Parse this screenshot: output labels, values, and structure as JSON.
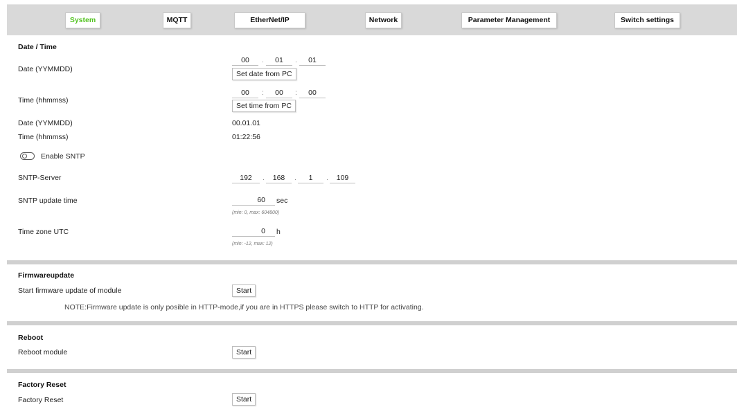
{
  "nav": {
    "tabs": [
      "System",
      "MQTT",
      "EtherNet/IP",
      "Network",
      "Parameter Management",
      "Switch settings"
    ],
    "active_color": "#55c323"
  },
  "datetime": {
    "heading": "Date / Time",
    "date_label": "Date (YYMMDD)",
    "date_segments": [
      "00",
      "01",
      "01"
    ],
    "set_date_button": "Set date from PC",
    "time_label": "Time (hhmmss)",
    "time_segments": [
      "00",
      "00",
      "00"
    ],
    "set_time_button": "Set time from PC",
    "current_date_label": "Date (YYMMDD)",
    "current_date_value": "00.01.01",
    "current_time_label": "Time (hhmmss)",
    "current_time_value": "01:22:56",
    "sntp_toggle_label": "Enable SNTP",
    "sntp_enabled": false,
    "sntp_server_label": "SNTP-Server",
    "sntp_server_octets": [
      "192",
      "168",
      "1",
      "109"
    ],
    "sntp_update_label": "SNTP update time",
    "sntp_update_value": "60",
    "sntp_update_unit": "sec",
    "sntp_update_hint": "(min: 0, max: 604800)",
    "timezone_label": "Time zone UTC",
    "timezone_value": "0",
    "timezone_unit": "h",
    "timezone_hint": "(min: -12, max: 12)"
  },
  "firmware": {
    "heading": "Firmwareupdate",
    "label": "Start firmware update of module",
    "button": "Start",
    "note": "NOTE:Firmware update is only posible in HTTP-mode,if you are in HTTPS please switch to HTTP for activating."
  },
  "reboot": {
    "heading": "Reboot",
    "label": "Reboot module",
    "button": "Start"
  },
  "factory": {
    "heading": "Factory Reset",
    "label": "Factory Reset",
    "button": "Start"
  }
}
